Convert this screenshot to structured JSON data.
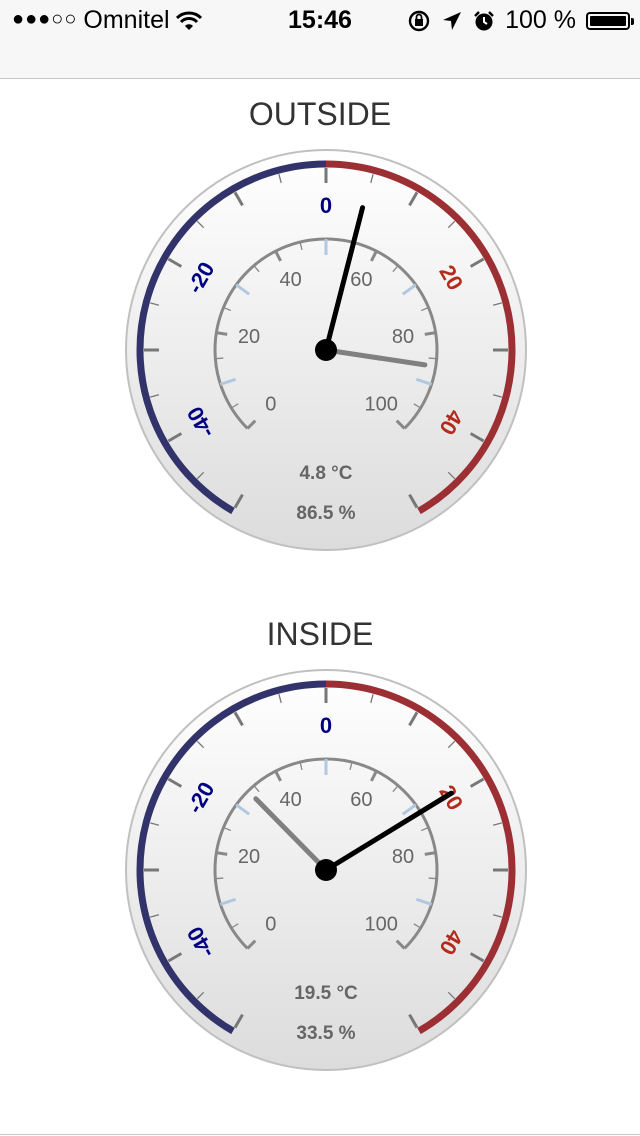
{
  "status_bar": {
    "signal": "●●●○○",
    "carrier": "Omnitel",
    "time": "15:46",
    "battery_text": "100 %",
    "icons": [
      "wifi-icon",
      "orientation-lock-icon",
      "location-arrow-icon",
      "alarm-clock-icon",
      "battery-icon"
    ]
  },
  "gauges": [
    {
      "title": "OUTSIDE",
      "temp_display": "4.8 °C",
      "humidity_display": "86.5 %",
      "temperature": 4.8,
      "humidity": 86.5
    },
    {
      "title": "INSIDE",
      "temp_display": "19.5 °C",
      "humidity_display": "33.5 %",
      "temperature": 19.5,
      "humidity": 33.5
    }
  ],
  "scales": {
    "temperature": {
      "min": -50,
      "max": 50,
      "labels": [
        "-40",
        "-20",
        "0",
        "20",
        "40"
      ]
    },
    "humidity": {
      "min": 0,
      "max": 100,
      "labels": [
        "0",
        "20",
        "40",
        "60",
        "80",
        "100"
      ]
    }
  },
  "colors": {
    "cold": "#33336b",
    "warm": "#9c2f33",
    "cold_label": "#000080",
    "warm_label": "#b22b1c",
    "humidity_scale": "#888888",
    "humidity_minor": "#b0c8e0",
    "temp_needle": "#000000",
    "humidity_needle": "#808080"
  }
}
